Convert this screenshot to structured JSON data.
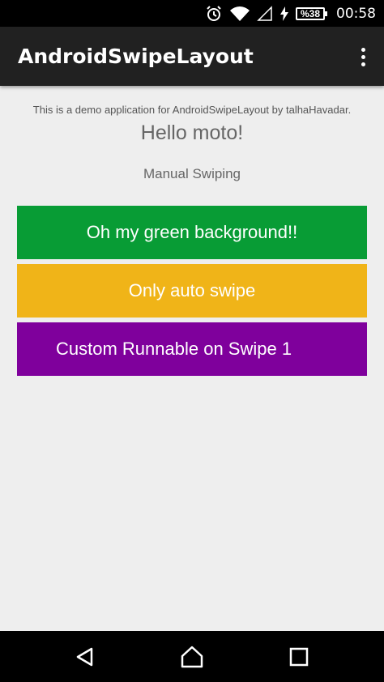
{
  "status_bar": {
    "time": "00:58",
    "battery_level": "%38",
    "icons": [
      "alarm-icon",
      "wifi-icon",
      "cell-signal-icon",
      "charging-icon",
      "battery-icon"
    ]
  },
  "app_bar": {
    "title": "AndroidSwipeLayout",
    "overflow_icon": "more-vert-icon"
  },
  "content": {
    "intro": "This is a demo application for AndroidSwipeLayout by talhaHavadar.",
    "hello": "Hello moto!",
    "manual_swiping": "Manual Swiping",
    "items": [
      {
        "label": "Oh my green background!!",
        "color": "#089c35"
      },
      {
        "label": "Only auto swipe",
        "color": "#f0b418"
      },
      {
        "label": "Custom Runnable on Swipe 1",
        "color": "#7f009c"
      }
    ]
  },
  "nav_bar": {
    "icons": [
      "back-icon",
      "home-icon",
      "recents-icon"
    ]
  },
  "colors": {
    "status_bar": "#000000",
    "app_bar": "#212121",
    "background": "#eeeeee"
  }
}
